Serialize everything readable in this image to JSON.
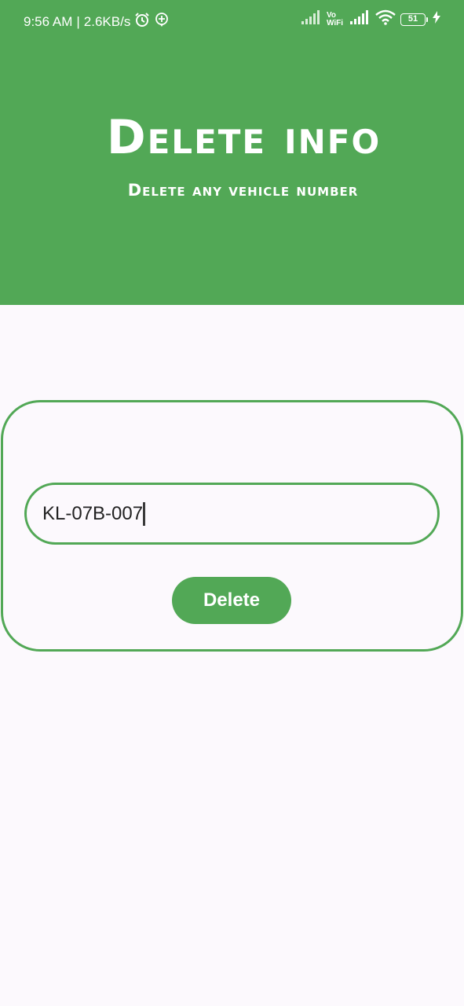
{
  "status_bar": {
    "time": "9:56 AM",
    "separator": "|",
    "net_speed": "2.6KB/s",
    "alarm_icon": "alarm-icon",
    "extra_icon": "location-plus-icon",
    "vowifi_top": "Vo",
    "vowifi_bottom": "WiFi",
    "battery_level": "51",
    "charging_icon": "bolt-icon"
  },
  "header": {
    "title": "Delete info",
    "subtitle": "Delete any vehicle number",
    "color": "#52a856"
  },
  "form": {
    "vehicle_number_value": "KL-07B-007",
    "delete_button_label": "Delete",
    "accent": "#52a856"
  }
}
